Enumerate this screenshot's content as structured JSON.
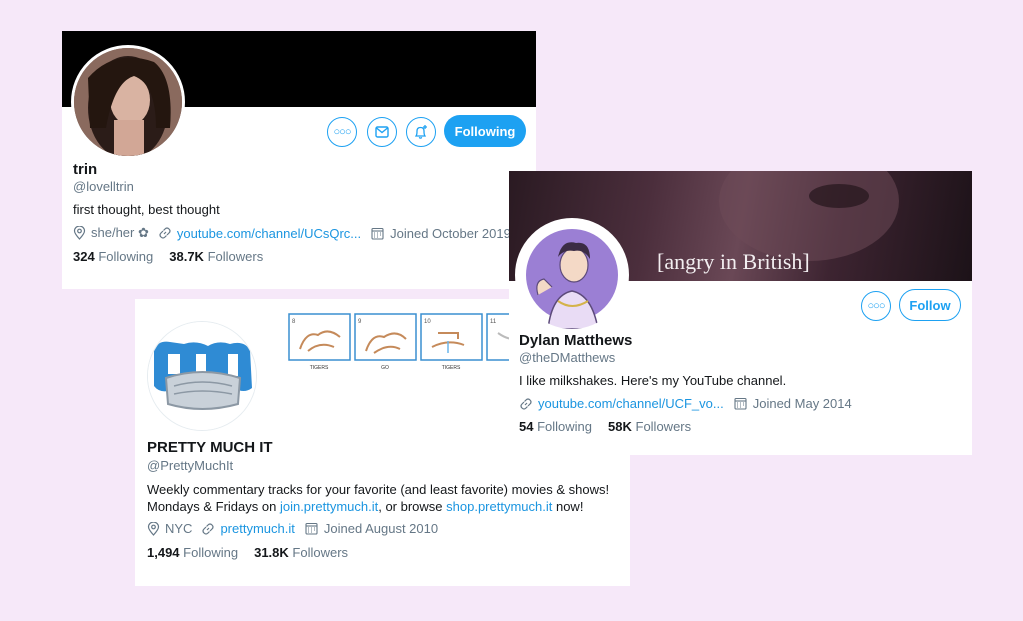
{
  "profiles": {
    "trin": {
      "display_name": "trin",
      "handle": "@lovelltrin",
      "bio": "first thought, best thought",
      "location": "she/her ✿",
      "website": "youtube.com/channel/UCsQrc...",
      "joined": "Joined October 2019",
      "following_count": "324",
      "following_label": "Following",
      "followers_count": "38.7K",
      "followers_label": "Followers",
      "follow_button": "Following"
    },
    "dylan": {
      "display_name": "Dylan Matthews",
      "handle": "@theDMatthews",
      "bio": "I like milkshakes. Here's my YouTube channel.",
      "banner_text": "[angry in British]",
      "website": "youtube.com/channel/UCF_vo...",
      "joined": "Joined May 2014",
      "following_count": "54",
      "following_label": "Following",
      "followers_count": "58K",
      "followers_label": "Followers",
      "follow_button": "Follow"
    },
    "pmi": {
      "display_name": "PRETTY MUCH IT",
      "handle": "@PrettyMuchIt",
      "bio_line1": "Weekly commentary tracks for your favorite (and least favorite) movies & shows!",
      "bio_line2_pre": "Mondays & Fridays on ",
      "bio_link1": "join.prettymuch.it",
      "bio_line2_mid": ", or browse ",
      "bio_link2": "shop.prettymuch.it",
      "bio_line2_post": " now!",
      "location": "NYC",
      "website": "prettymuch.it",
      "joined": "Joined August 2010",
      "following_count": "1,494",
      "following_label": "Following",
      "followers_count": "31.8K",
      "followers_label": "Followers",
      "banner_panels": [
        {
          "num": "8",
          "caption": "TIGERS"
        },
        {
          "num": "9",
          "caption": "GO"
        },
        {
          "num": "10",
          "caption": "TIGERS"
        },
        {
          "num": "11",
          "caption": ""
        }
      ]
    }
  },
  "icons": {
    "more": "more-icon",
    "message": "envelope-icon",
    "notify": "bell-plus-icon",
    "location": "location-pin-icon",
    "link": "link-icon",
    "calendar": "calendar-icon"
  },
  "colors": {
    "accent": "#1da1f2",
    "link": "#1b95e0",
    "background": "#f6e8f9"
  }
}
